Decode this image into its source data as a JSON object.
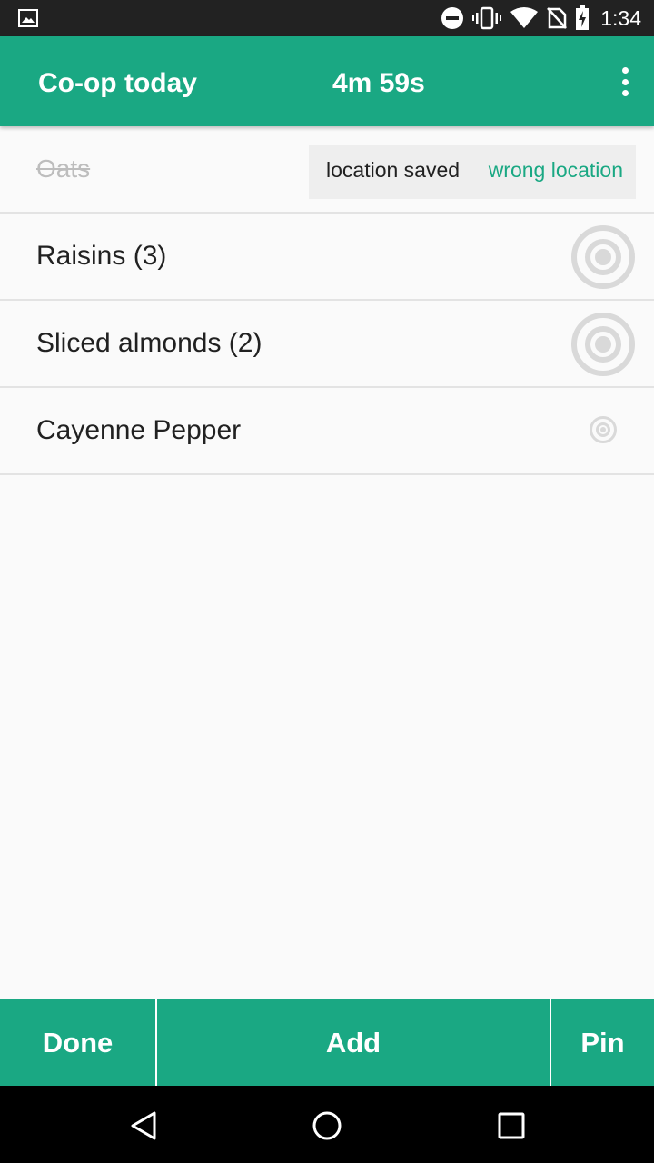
{
  "status_bar": {
    "time": "1:34",
    "icons": [
      "image-notification-icon",
      "do-not-disturb-icon",
      "vibrate-icon",
      "wifi-icon",
      "no-sim-icon",
      "battery-charging-icon"
    ]
  },
  "app_bar": {
    "title": "Co-op today",
    "timer": "4m 59s",
    "menu_icon": "overflow-menu-icon"
  },
  "list": {
    "items": [
      {
        "label": "Oats",
        "checked": true
      },
      {
        "label": "Raisins (3)",
        "checked": false,
        "icon": "location-target-icon"
      },
      {
        "label": "Sliced almonds (2)",
        "checked": false,
        "icon": "location-target-icon"
      },
      {
        "label": "Cayenne Pepper",
        "checked": false,
        "icon": "location-target-icon"
      }
    ]
  },
  "snackbar": {
    "message": "location saved",
    "action": "wrong location"
  },
  "bottom_bar": {
    "done_label": "Done",
    "add_label": "Add",
    "pin_label": "Pin"
  },
  "nav_bar": {
    "icons": [
      "back-icon",
      "home-icon",
      "recents-icon"
    ]
  },
  "colors": {
    "accent": "#1aa883",
    "status_bar": "#222222",
    "background": "#fafafa",
    "target_grey": "#d9d9d9"
  }
}
